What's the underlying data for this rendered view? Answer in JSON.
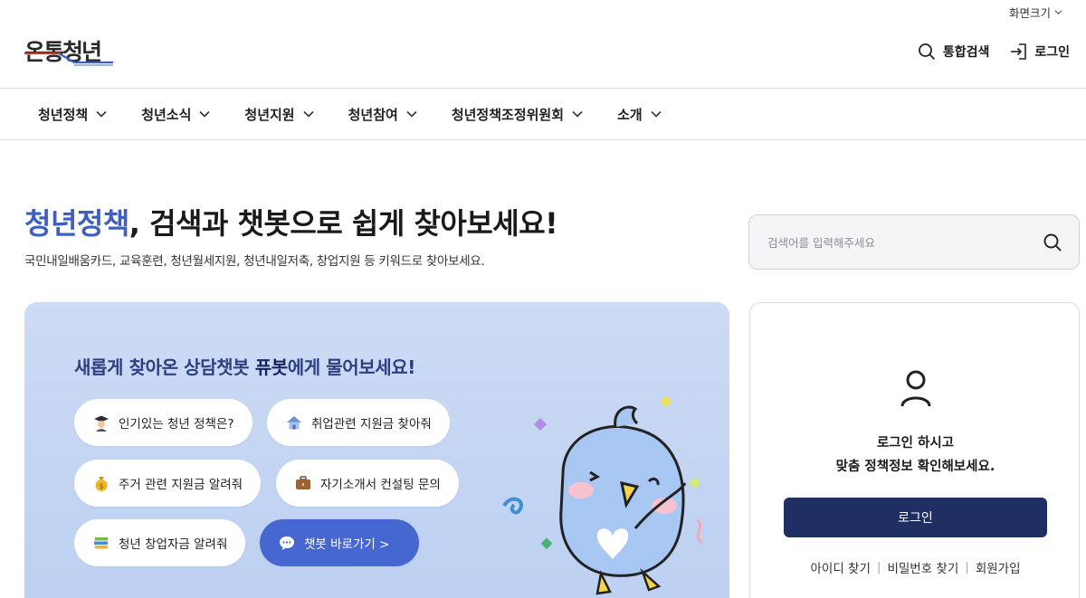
{
  "utility": {
    "screen_size_label": "화면크기"
  },
  "brand": {
    "logo_text": "온통청년"
  },
  "header": {
    "search_label": "통합검색",
    "login_label": "로그인"
  },
  "gnb": {
    "items": [
      {
        "label": "청년정책"
      },
      {
        "label": "청년소식"
      },
      {
        "label": "청년지원"
      },
      {
        "label": "청년참여"
      },
      {
        "label": "청년정책조정위원회"
      },
      {
        "label": "소개"
      }
    ]
  },
  "hero": {
    "title_accent": "청년정책",
    "title_rest": ", 검색과 챗봇으로 쉽게 찾아보세요!",
    "subtitle": "국민내일배움카드, 교육훈련, 청년월세지원, 청년내일저축, 창업지원 등 키워드로 찾아보세요."
  },
  "search": {
    "placeholder": "검색어를 입력해주세요"
  },
  "chatbot": {
    "title_prefix": "새롭게 찾아온 상담챗봇 ",
    "title_bold": "퓨봇",
    "title_suffix": "에게 물어보세요!",
    "chips": [
      {
        "label": "인기있는 청년 정책은?",
        "icon": "graduate-icon"
      },
      {
        "label": "취업관련 지원금 찾아줘",
        "icon": "house-icon"
      },
      {
        "label": "주거 관련 지원금 알려줘",
        "icon": "money-bag-icon"
      },
      {
        "label": "자기소개서 컨설팅 문의",
        "icon": "briefcase-icon"
      },
      {
        "label": "청년 창업자금 알려줘",
        "icon": "books-icon"
      }
    ],
    "cta_label": "챗봇 바로가기 >"
  },
  "login_panel": {
    "message_line1": "로그인 하시고",
    "message_line2": "맞춤 정책정보 확인해보세요.",
    "button_label": "로그인",
    "find_id": "아이디 찾기",
    "find_password": "비밀번호 찾기",
    "signup": "회원가입"
  },
  "colors": {
    "accent": "#3d5fc4",
    "primary_button": "#1f2f63",
    "chat_cta": "#4667d0",
    "chat_background": "#c7d8f4"
  }
}
